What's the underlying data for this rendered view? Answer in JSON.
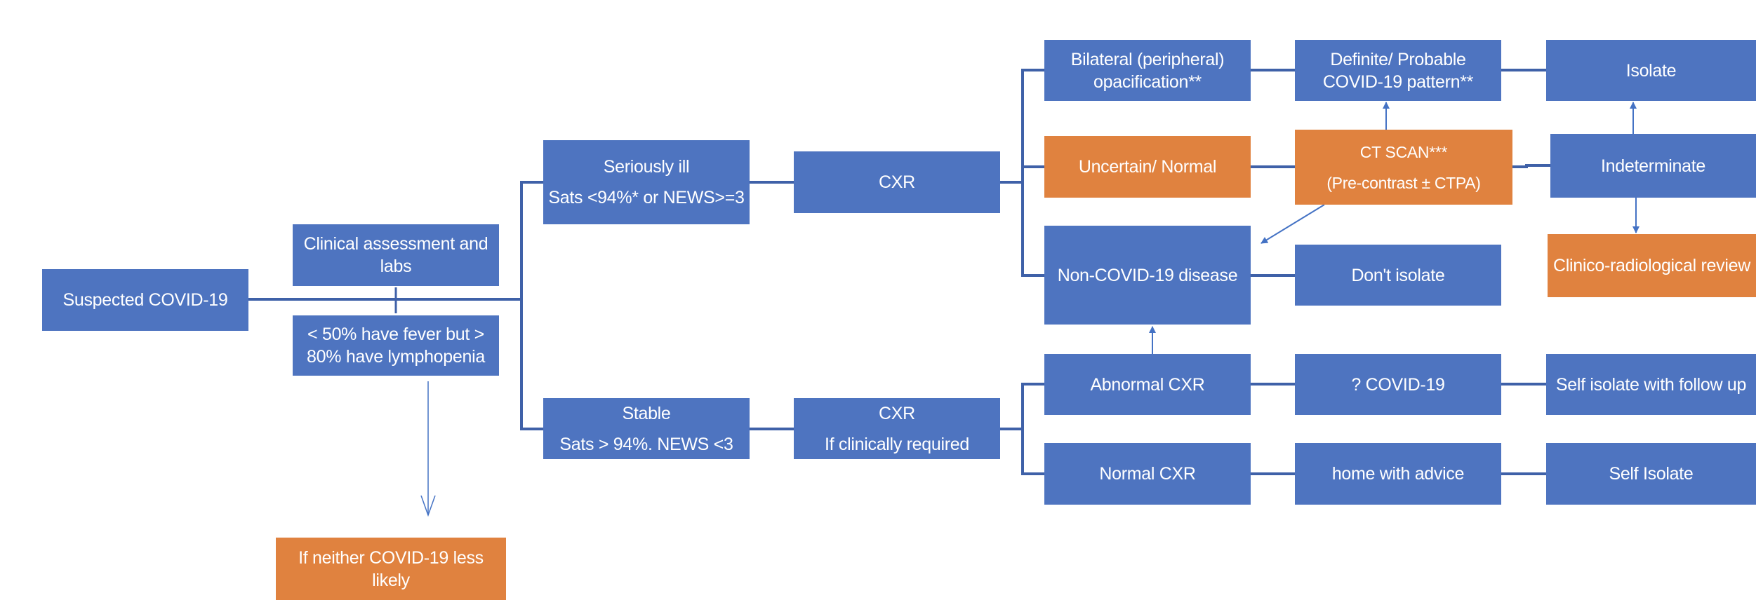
{
  "colors": {
    "primary_node": "#4E74C0",
    "alert_node": "#E0823F",
    "connector": "#3F61A8"
  },
  "nodes": {
    "suspected": "Suspected COVID-19",
    "clinical": "Clinical assessment and labs",
    "lymphopenia": "< 50% have fever but > 80% have lymphopenia",
    "neither": "If neither COVID-19 less likely",
    "seriously_ill": {
      "title": "Seriously ill",
      "criteria": "Sats <94%* or NEWS>=3"
    },
    "stable": {
      "title": "Stable",
      "criteria": "Sats > 94%. NEWS <3"
    },
    "cxr_ill": "CXR",
    "cxr_stable": {
      "title": "CXR",
      "note": "If clinically required"
    },
    "bilateral": "Bilateral (peripheral) opacification**",
    "uncertain": "Uncertain/ Normal",
    "non_covid": "Non-COVID-19 disease",
    "abnormal_cxr": "Abnormal CXR",
    "normal_cxr": "Normal CXR",
    "definite": "Definite/ Probable COVID-19 pattern**",
    "ct_scan": {
      "title": "CT SCAN***",
      "note": "(Pre-contrast ± CTPA)"
    },
    "dont_isolate": "Don't isolate",
    "query_covid": "? COVID-19",
    "home_advice": "home with advice",
    "isolate": "Isolate",
    "indeterminate": "Indeterminate",
    "clinico_review": "Clinico-radiological review",
    "self_isolate_follow": "Self isolate with follow up",
    "self_isolate": "Self Isolate"
  }
}
